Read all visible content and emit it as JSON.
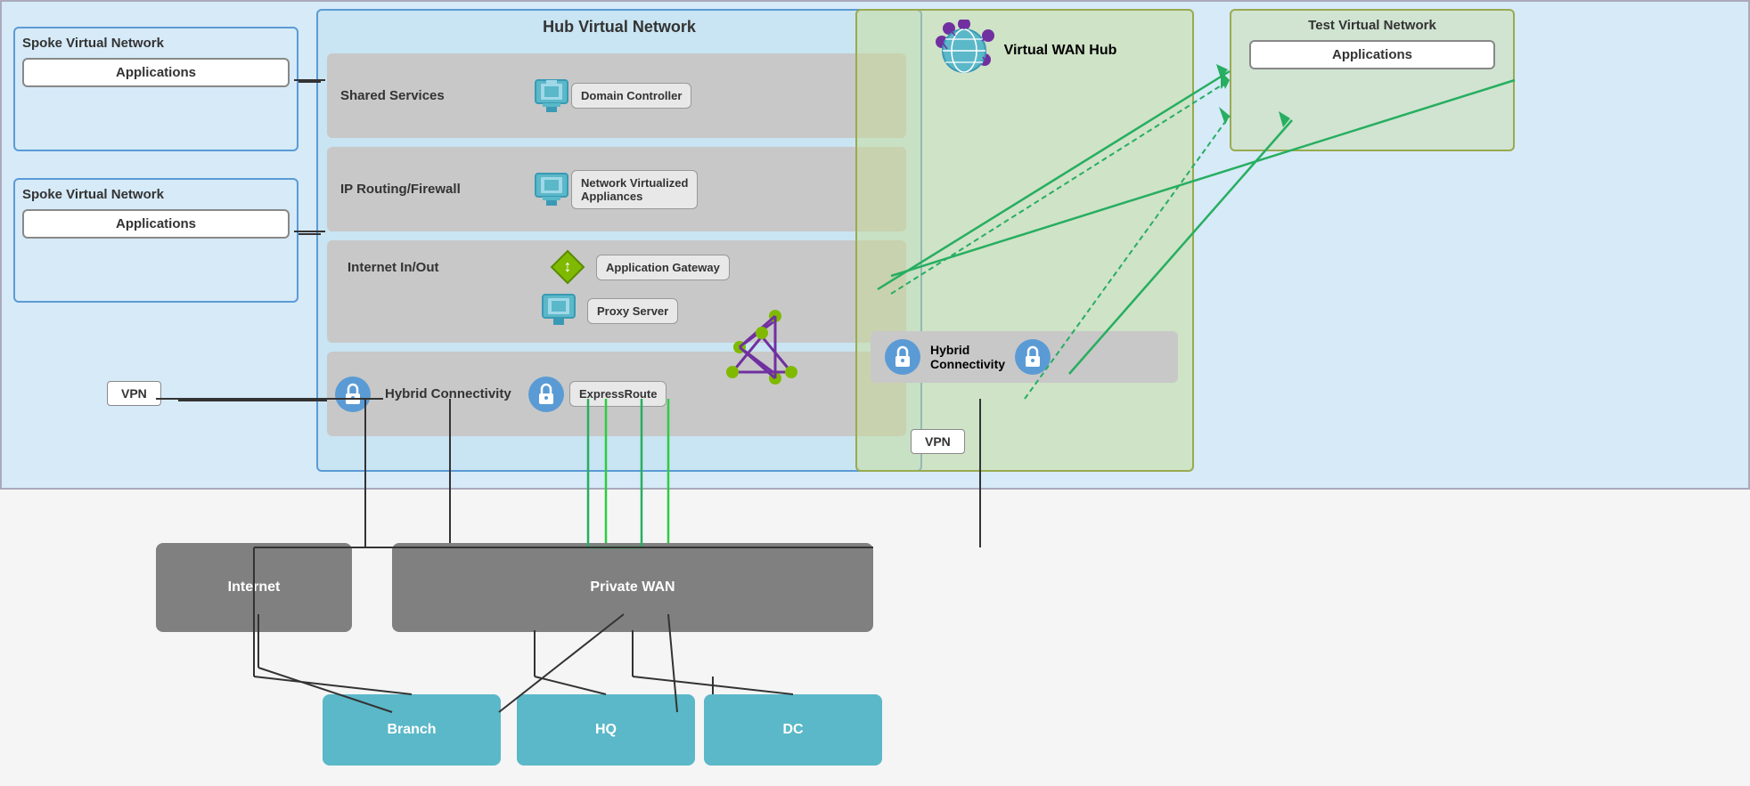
{
  "spoke1": {
    "title": "Spoke Virtual Network",
    "app_label": "Applications"
  },
  "spoke2": {
    "title": "Spoke Virtual Network",
    "app_label": "Applications"
  },
  "hub": {
    "title": "Hub Virtual Network",
    "rows": [
      {
        "id": "shared-services",
        "label": "Shared Services",
        "service": "Domain Controller"
      },
      {
        "id": "ip-routing",
        "label": "IP Routing/Firewall",
        "service": "Network  Virtualized\nAppliances"
      },
      {
        "id": "internet-inout",
        "label": "Internet In/Out",
        "services": [
          "Application Gateway",
          "Proxy Server"
        ]
      },
      {
        "id": "hybrid-connectivity",
        "label": "Hybrid Connectivity",
        "services": [
          "ExpressRoute"
        ]
      }
    ]
  },
  "wan_hub": {
    "title": "Virtual WAN Hub"
  },
  "test_vnet": {
    "title": "Test Virtual Network",
    "app_label": "Applications"
  },
  "vpn_left": "VPN",
  "vpn_right": "VPN",
  "express_route": "ExpressRoute",
  "bottom": {
    "internet": "Internet",
    "private_wan": "Private WAN",
    "branch": "Branch",
    "hq": "HQ",
    "dc": "DC"
  },
  "hybrid_connectivity_wan": "Hybrid\nConnectivity"
}
